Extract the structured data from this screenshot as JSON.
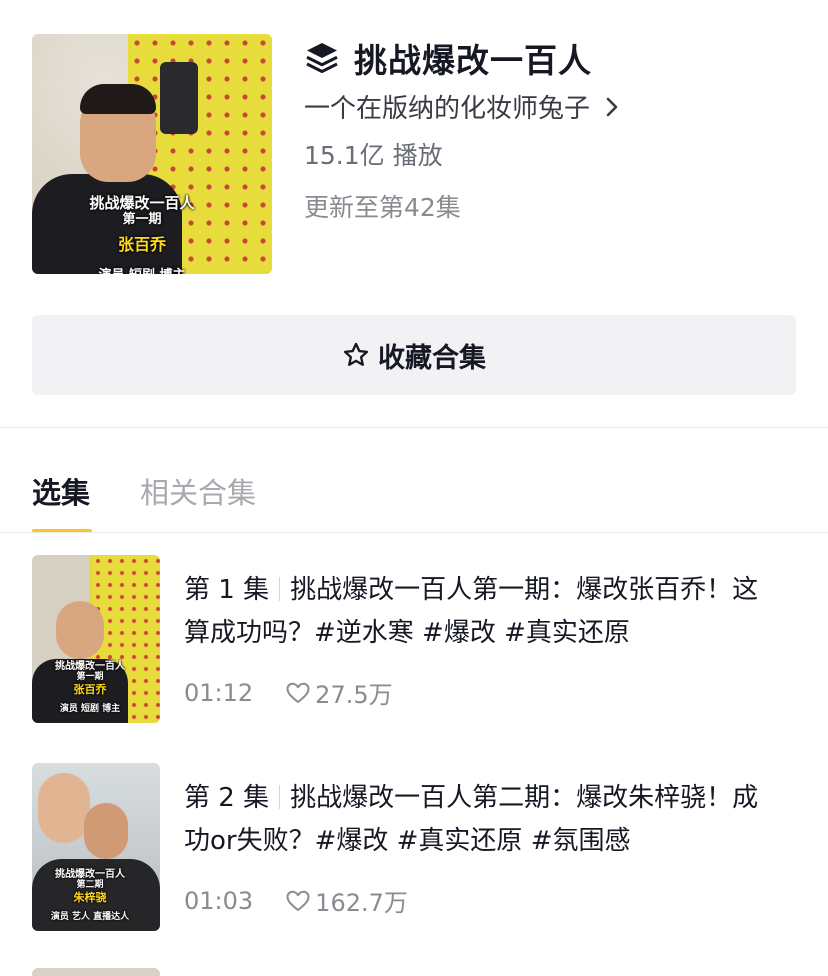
{
  "collection": {
    "title": "挑战爆改一百人",
    "author": "一个在版纳的化妆师兔子",
    "plays": "15.1亿 播放",
    "updated": "更新至第42集",
    "cover_captions": [
      "挑战爆改一百人",
      "第一期",
      "张百乔",
      "演员 短剧 博主"
    ],
    "favorite_label": "收藏合集"
  },
  "tabs": [
    {
      "label": "选集",
      "active": true
    },
    {
      "label": "相关合集",
      "active": false
    }
  ],
  "episodes": [
    {
      "number": "第 1 集",
      "title": "挑战爆改一百人第一期：爆改张百乔！这算成功吗？#逆水寒 #爆改 #真实还原",
      "duration": "01:12",
      "likes": "27.5万",
      "thumb_captions": [
        "挑战爆改一百人",
        "第一期",
        "张百乔",
        "演员 短剧 博主"
      ]
    },
    {
      "number": "第 2 集",
      "title": "挑战爆改一百人第二期：爆改朱梓骁！成功or失败？#爆改 #真实还原 #氛围感",
      "duration": "01:03",
      "likes": "162.7万",
      "thumb_captions": [
        "挑战爆改一百人",
        "第二期",
        "朱梓骁",
        "演员 艺人 直播达人"
      ]
    }
  ],
  "colors": {
    "accent_underline": "#fbc61c",
    "button_bg": "#f2f2f4",
    "text_primary": "#161823",
    "text_secondary": "#8a8b91",
    "caption_highlight": "#ffd91a"
  },
  "icons": {
    "collection": "stack-layers-icon",
    "author_arrow": "chevron-right-icon",
    "favorite": "star-outline-icon",
    "likes": "heart-outline-icon"
  }
}
